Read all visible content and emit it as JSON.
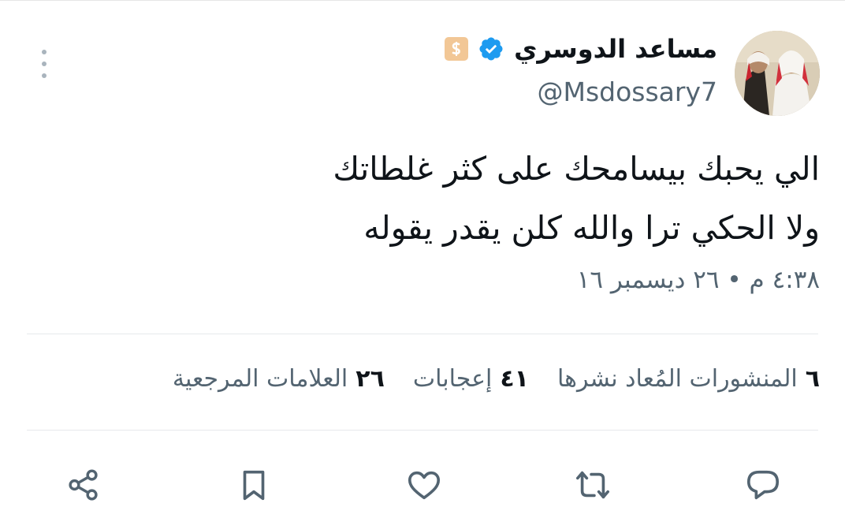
{
  "author": {
    "name": "مساعد الدوسري",
    "handle": "@Msdossary7",
    "verified": true,
    "flair_icon": "dollar-badge-icon"
  },
  "tweet": {
    "lines": [
      "الي يحبك بيسامحك على كثر غلطاتك",
      "ولا الحكي ترا والله كلن يقدر يقوله"
    ],
    "timestamp": "٤:٣٨ م • ٢٦ ديسمبر ١٦"
  },
  "stats": {
    "retweets_count": "٦",
    "retweets_label": "المنشورات المُعاد نشرها",
    "likes_count": "٤١",
    "likes_label": "إعجابات",
    "bookmarks_count": "٢٦",
    "bookmarks_label": "العلامات المرجعية"
  },
  "actions": [
    "reply-icon",
    "retweet-icon",
    "like-icon",
    "bookmark-icon",
    "share-icon"
  ],
  "colors": {
    "verified": "#1d9bf0",
    "secondary_text": "#536471",
    "primary_text": "#0f1419",
    "icon": "#536471"
  }
}
